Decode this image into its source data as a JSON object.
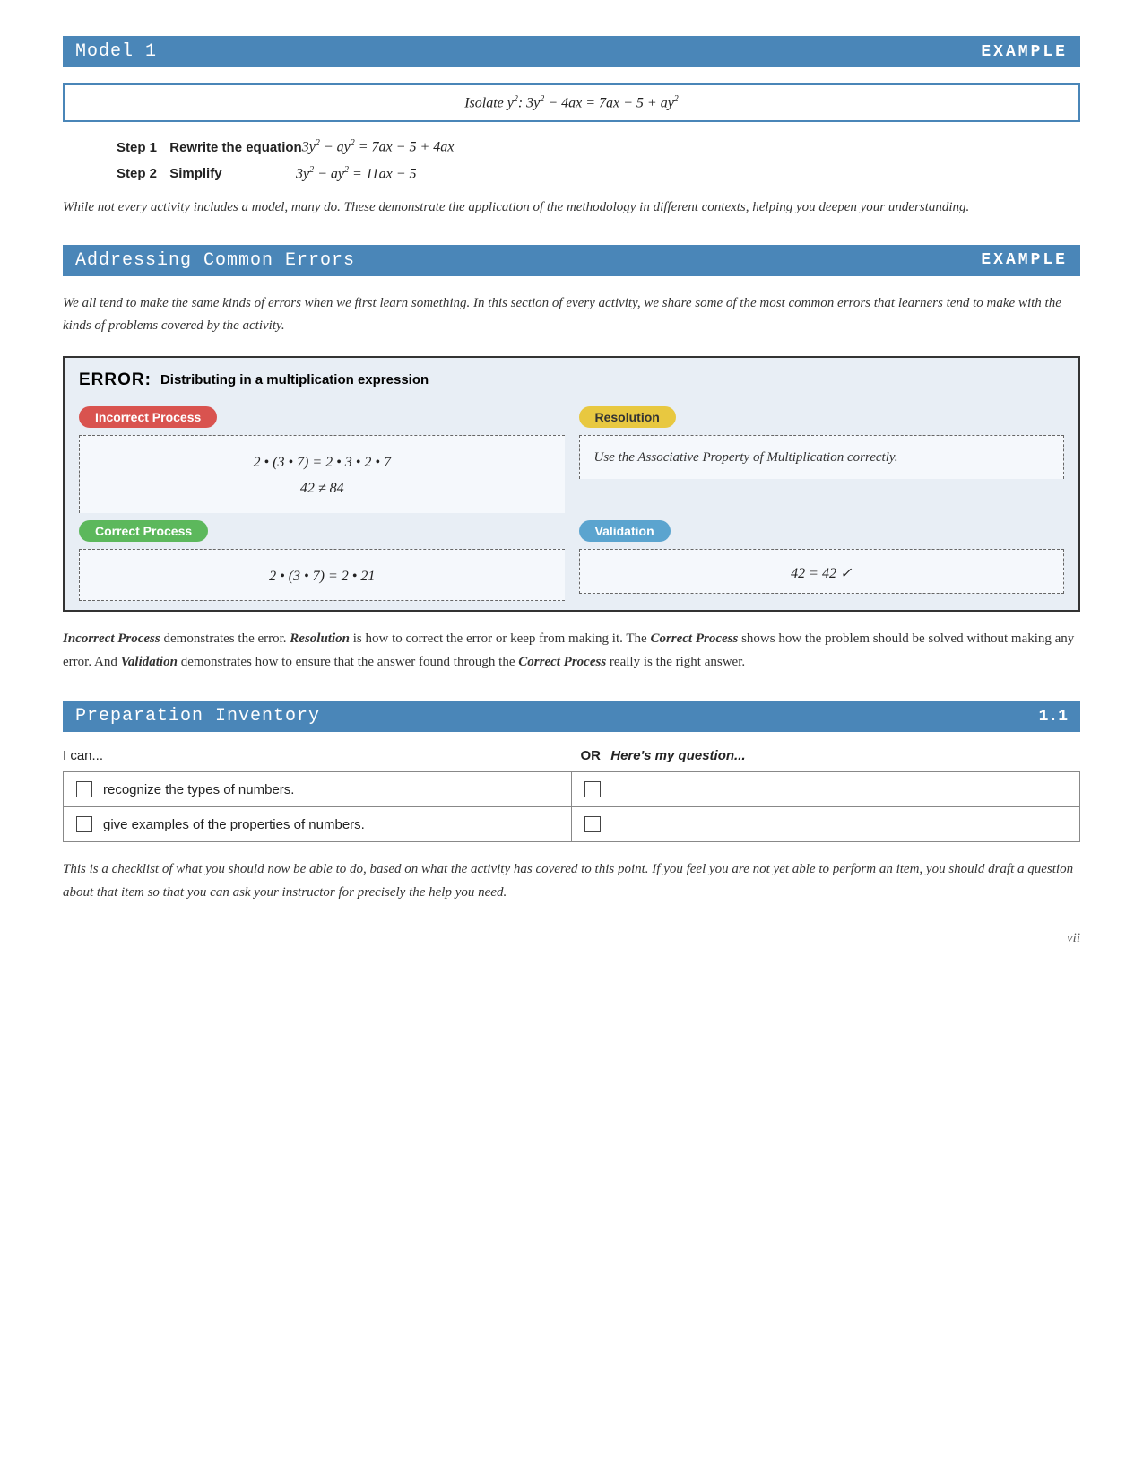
{
  "model1": {
    "header_title": "Model 1",
    "header_tag": "EXAMPLE",
    "isolate_text": "Isolate y²: 3y² − 4ax = 7ax − 5 + ay²",
    "step1_label": "Step 1",
    "step1_name": "Rewrite the equation",
    "step1_eq": "3y² − ay² = 7ax − 5 + 4ax",
    "step2_label": "Step 2",
    "step2_name": "Simplify",
    "step2_eq": "3y² − ay² = 11ax − 5",
    "note": "While not every activity includes a model, many do. These demonstrate the application of the methodology in different contexts, helping you deepen your understanding."
  },
  "ace": {
    "header_title": "Addressing Common Errors",
    "header_tag": "EXAMPLE",
    "intro": "We all tend to make the same kinds of errors when we first learn something. In this section of every activity, we share some of the most common errors that learners tend to make with the kinds of problems covered by the activity.",
    "error_label": "ERROR:",
    "error_desc": "Distributing in a multiplication expression",
    "incorrect_badge": "Incorrect Process",
    "resolution_badge": "Resolution",
    "correct_badge": "Correct Process",
    "validation_badge": "Validation",
    "incorrect_eq_line1": "2 • (3 • 7) = 2 • 3 • 2 • 7",
    "incorrect_eq_line2": "42 ≠ 84",
    "resolution_text": "Use the Associative Property of Multiplication correctly.",
    "correct_eq": "2 • (3 • 7) = 2 • 21",
    "validation_eq": "42 = 42 ✓",
    "explanation": "Incorrect Process demonstrates the error. Resolution is how to correct the error or keep from making it. The Correct Process shows how the problem should be solved without making any error. And Validation demonstrates how to ensure that the answer found through the Correct Process really is the right answer."
  },
  "prep": {
    "header_title": "Preparation Inventory",
    "header_num": "1.1",
    "i_can": "I can...",
    "or_label": "OR",
    "my_question": "Here's my question...",
    "items": [
      {
        "left_text": "recognize the types of numbers."
      },
      {
        "left_text": "give examples of the properties of numbers."
      }
    ],
    "note": "This is a checklist of what you should now be able to do, based on what the activity has covered to this point. If you feel you are not yet able to perform an item, you should draft a question about that item so that you can ask your instructor for precisely the help you need."
  },
  "page": {
    "number": "vii"
  }
}
